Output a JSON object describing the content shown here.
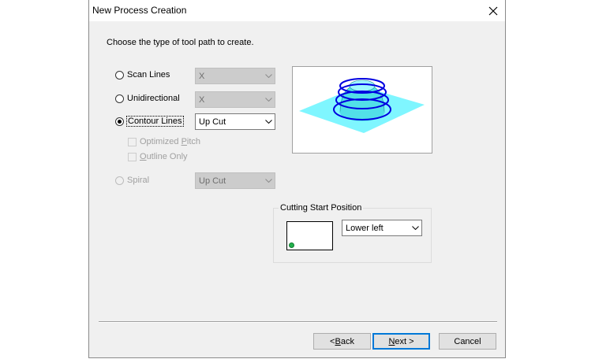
{
  "dialog": {
    "title": "New Process Creation",
    "instruction": "Choose the type of tool path to create."
  },
  "options": {
    "scan_lines": {
      "label": "Scan Lines",
      "combo_value": "X"
    },
    "unidirectional": {
      "label": "Unidirectional",
      "combo_value": "X"
    },
    "contour_lines": {
      "label": "Contour Lines",
      "combo_value": "Up Cut",
      "optimized_pitch_pre": "Optimized ",
      "optimized_pitch_u": "P",
      "optimized_pitch_post": "itch",
      "outline_only_u": "O",
      "outline_only_post": "utline Only"
    },
    "spiral": {
      "label": "Spiral",
      "combo_value": "Up Cut"
    }
  },
  "cutting_start": {
    "title": "Cutting Start Position",
    "value": "Lower left"
  },
  "buttons": {
    "back_pre": "< ",
    "back_u": "B",
    "back_post": "ack",
    "next_u": "N",
    "next_post": "ext >",
    "cancel": "Cancel"
  },
  "colors": {
    "plane": "#7ff6ff",
    "contour": "#0000e0",
    "start_dot": "#22b14c"
  }
}
